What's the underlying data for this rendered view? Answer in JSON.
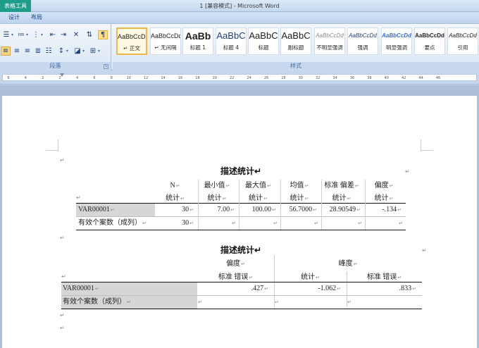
{
  "window": {
    "title": "1 [兼容模式] - Microsoft Word",
    "context_tools_label": "表格工具"
  },
  "tabs": [
    {
      "label": "设计"
    },
    {
      "label": "布局"
    }
  ],
  "ribbon": {
    "paragraph_group_label": "段落",
    "styles_group_label": "样式",
    "style_tiles": [
      {
        "sample": "AaBbCcDd",
        "name": "↵ 正文",
        "selected": true
      },
      {
        "sample": "AaBbCcDd",
        "name": "↵ 无间隔",
        "selected": false
      },
      {
        "sample": "AaBb",
        "name": "标题 1",
        "selected": false
      },
      {
        "sample": "AaBbC",
        "name": "标题 4",
        "selected": false
      },
      {
        "sample": "AaBbC",
        "name": "标题",
        "selected": false
      },
      {
        "sample": "AaBbC",
        "name": "副标题",
        "selected": false
      },
      {
        "sample": "AaBbCcDd",
        "name": "不明显强调",
        "selected": false
      },
      {
        "sample": "AaBbCcDd",
        "name": "强调",
        "selected": false
      },
      {
        "sample": "AaBbCcDd",
        "name": "明显强调",
        "selected": false
      },
      {
        "sample": "AaBbCcDd",
        "name": "要点",
        "selected": false
      },
      {
        "sample": "AaBbCcDd",
        "name": "引用",
        "selected": false
      }
    ],
    "accent_color": "#1f9d8b",
    "selected_style_border": "#f0b74a"
  },
  "ruler": {
    "ticks": [
      "6",
      "4",
      "2",
      "2",
      "4",
      "6",
      "8",
      "10",
      "12",
      "14",
      "16",
      "18",
      "20",
      "22",
      "24",
      "26",
      "28",
      "30",
      "32",
      "34",
      "36",
      "38",
      "40",
      "42",
      "44",
      "46"
    ]
  },
  "document": {
    "paragraph_mark": "↵",
    "table1": {
      "title": "描述统计",
      "header_top": [
        "N",
        "最小值",
        "最大值",
        "均值",
        "标准 偏差",
        "偏度"
      ],
      "header_sub": [
        "统计",
        "统计",
        "统计",
        "统计",
        "统计",
        "统计"
      ],
      "rows": [
        {
          "label": "VAR00001",
          "values": [
            "30",
            "7.00",
            "100.00",
            "56.7000",
            "28.90549",
            "-.134"
          ]
        },
        {
          "label": "有效个案数（成列）",
          "values": [
            "30",
            "",
            "",
            "",
            "",
            ""
          ]
        }
      ]
    },
    "table2": {
      "title": "描述统计",
      "header_top": [
        "偏度",
        "峰度"
      ],
      "header_sub": [
        "标准 错误",
        "统计",
        "标准 错误"
      ],
      "rows": [
        {
          "label": "VAR00001",
          "values": [
            ".427",
            "-1.062",
            ".833"
          ]
        },
        {
          "label": "有效个案数（成列）",
          "values": [
            "",
            "",
            ""
          ]
        }
      ]
    }
  }
}
